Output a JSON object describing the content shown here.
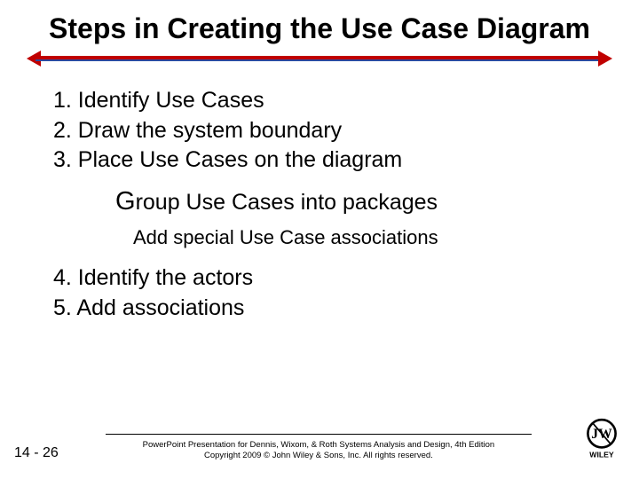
{
  "title": "Steps in Creating the Use Case Diagram",
  "items": {
    "i1": "1. Identify Use Cases",
    "i2": "2. Draw the system boundary",
    "i3": "3. Place Use Cases on the diagram",
    "i3a_prefix": "G",
    "i3a_rest": "roup Use Cases into packages",
    "i3b": "Add special Use Case associations",
    "i4": "4. Identify the actors",
    "i5": "5. Add associations"
  },
  "footer": {
    "page": "14 - 26",
    "line1": "PowerPoint Presentation for Dennis, Wixom, & Roth Systems Analysis and Design, 4th Edition",
    "line2": "Copyright 2009 © John Wiley & Sons, Inc.  All rights reserved."
  },
  "logo": {
    "name": "wiley-logo",
    "text": "WILEY"
  }
}
